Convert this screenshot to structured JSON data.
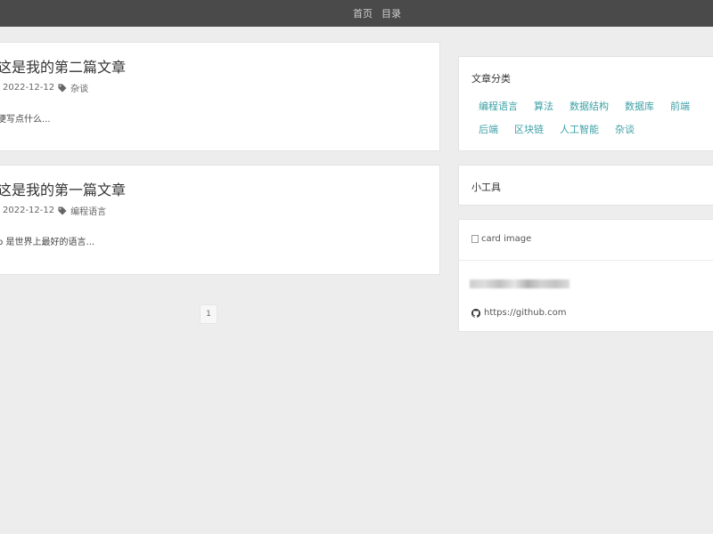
{
  "nav": {
    "home": "首页",
    "catalog": "目录"
  },
  "posts": [
    {
      "title": "这是我的第二篇文章",
      "date": "2022-12-12",
      "category": "杂谈",
      "excerpt": "便写点什么..."
    },
    {
      "title": "这是我的第一篇文章",
      "date": "2022-12-12",
      "category": "编程语言",
      "excerpt": "p 是世界上最好的语言..."
    }
  ],
  "pagination": {
    "current": "1"
  },
  "sidebar": {
    "categories": {
      "title": "文章分类",
      "items": [
        "编程语言",
        "算法",
        "数据结构",
        "数据库",
        "前端",
        "后端",
        "区块链",
        "人工智能",
        "杂谈"
      ]
    },
    "tools": {
      "title": "小工具"
    },
    "profile": {
      "image_alt": "card image",
      "link": "https://github.com"
    }
  },
  "colors": {
    "topbar": "#4a4a4a",
    "background": "#ededee",
    "category_link": "#3fa1a6"
  }
}
